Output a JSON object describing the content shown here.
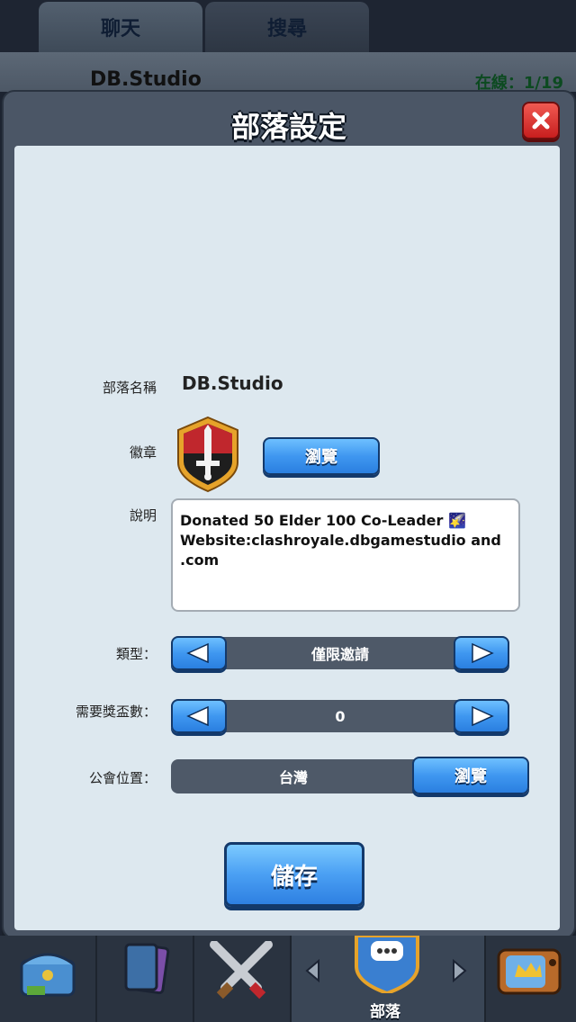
{
  "tabs": {
    "chat": "聊天",
    "search": "搜尋"
  },
  "clan_strip": {
    "name": "DB.Studio",
    "online": "在線：1/19"
  },
  "modal": {
    "title": "部落設定",
    "labels": {
      "clan_name": "部落名稱",
      "badge": "徽章",
      "description": "說明",
      "type": "類型：",
      "trophies": "需要獎盃數：",
      "location": "公會位置："
    },
    "clan_name": "DB.Studio",
    "badge_browse": "瀏覽",
    "description": "Donated 50 Elder 100 Co-Leader 🌠 Website:clashroyale.dbgamestudio and .com",
    "type_value": "僅限邀請",
    "trophies_value": "0",
    "location_value": "台灣",
    "location_browse": "瀏覽",
    "save": "儲存"
  },
  "bottom_nav": {
    "clan_label": "部落"
  },
  "colors": {
    "accent_blue": "#3f97f0",
    "close_red": "#d93030",
    "panel": "#dde8ef"
  }
}
